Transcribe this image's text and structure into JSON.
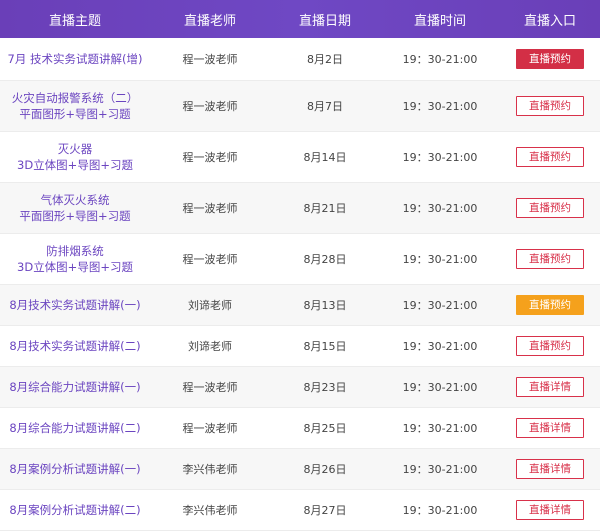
{
  "headers": [
    "直播主题",
    "直播老师",
    "直播日期",
    "直播时间",
    "直播入口"
  ],
  "rows": [
    {
      "topic": "7月 技术实务试题讲解(增)",
      "teacher": "程一波老师",
      "date": "8月2日",
      "time": "19：30-21:00",
      "action": "直播预约",
      "style": "filled-red",
      "height": 42
    },
    {
      "topic": "火灾自动报警系统（二）\n平面图形+导图+习题",
      "teacher": "程一波老师",
      "date": "8月7日",
      "time": "19：30-21:00",
      "action": "直播预约",
      "style": "outline",
      "height": 50
    },
    {
      "topic": "灭火器\n3D立体图+导图+习题",
      "teacher": "程一波老师",
      "date": "8月14日",
      "time": "19：30-21:00",
      "action": "直播预约",
      "style": "outline",
      "height": 50
    },
    {
      "topic": "气体灭火系统\n平面图形+导图+习题",
      "teacher": "程一波老师",
      "date": "8月21日",
      "time": "19：30-21:00",
      "action": "直播预约",
      "style": "outline",
      "height": 50
    },
    {
      "topic": "防排烟系统\n3D立体图+导图+习题",
      "teacher": "程一波老师",
      "date": "8月28日",
      "time": "19：30-21:00",
      "action": "直播预约",
      "style": "outline",
      "height": 50
    },
    {
      "topic": "8月技术实务试题讲解(一)",
      "teacher": "刘谛老师",
      "date": "8月13日",
      "time": "19：30-21:00",
      "action": "直播预约",
      "style": "filled-orange",
      "height": 40
    },
    {
      "topic": "8月技术实务试题讲解(二)",
      "teacher": "刘谛老师",
      "date": "8月15日",
      "time": "19：30-21:00",
      "action": "直播预约",
      "style": "outline",
      "height": 40
    },
    {
      "topic": "8月综合能力试题讲解(一)",
      "teacher": "程一波老师",
      "date": "8月23日",
      "time": "19：30-21:00",
      "action": "直播详情",
      "style": "outline",
      "height": 40
    },
    {
      "topic": "8月综合能力试题讲解(二)",
      "teacher": "程一波老师",
      "date": "8月25日",
      "time": "19：30-21:00",
      "action": "直播详情",
      "style": "outline",
      "height": 40
    },
    {
      "topic": "8月案例分析试题讲解(一)",
      "teacher": "李兴伟老师",
      "date": "8月26日",
      "time": "19：30-21:00",
      "action": "直播详情",
      "style": "outline",
      "height": 40
    },
    {
      "topic": "8月案例分析试题讲解(二)",
      "teacher": "李兴伟老师",
      "date": "8月27日",
      "time": "19：30-21:00",
      "action": "直播详情",
      "style": "outline",
      "height": 40
    }
  ],
  "colors": {
    "header_bg": "#6a3fb8",
    "topic_text": "#6b45c0",
    "accent_red": "#d32f46",
    "accent_orange": "#f5a11c"
  }
}
